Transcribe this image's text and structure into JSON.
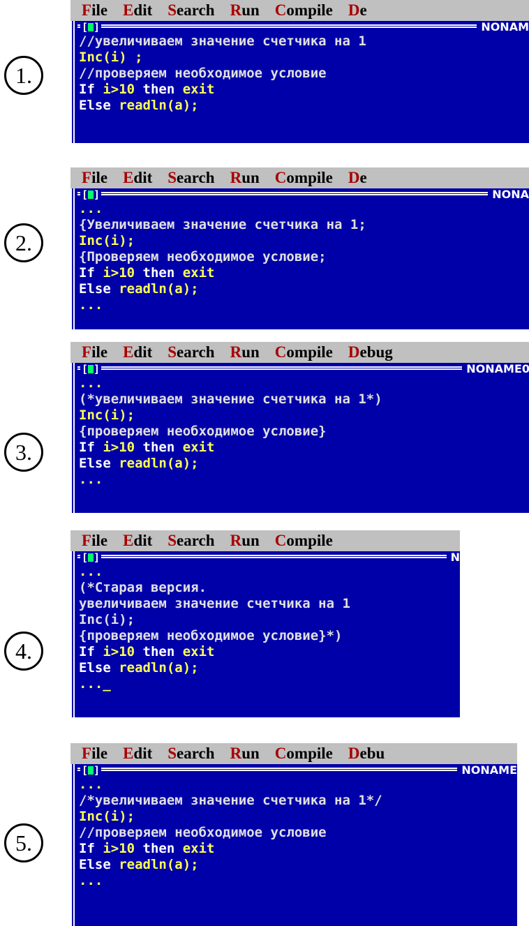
{
  "menu": [
    {
      "hot": "F",
      "rest": "ile"
    },
    {
      "hot": "E",
      "rest": "dit"
    },
    {
      "hot": "S",
      "rest": "earch"
    },
    {
      "hot": "R",
      "rest": "un"
    },
    {
      "hot": "C",
      "rest": "ompile"
    },
    {
      "hot": "D",
      "rest": "ebug"
    }
  ],
  "options": [
    {
      "number": "1.",
      "file_name": "NONAM",
      "lines": [
        [
          {
            "t": "cm",
            "v": "//увеличиваем значение счетчика на 1"
          }
        ],
        [
          {
            "t": "id",
            "v": "Inc(i) ;"
          }
        ],
        [
          {
            "t": "cm",
            "v": "//проверяем необходимое условие"
          }
        ],
        [
          {
            "t": "kw",
            "v": "If "
          },
          {
            "t": "id",
            "v": "i>10"
          },
          {
            "t": "kw",
            "v": " then "
          },
          {
            "t": "id",
            "v": "exit"
          }
        ],
        [
          {
            "t": "kw",
            "v": "Else "
          },
          {
            "t": "id",
            "v": "readln(a);"
          }
        ]
      ]
    },
    {
      "number": "2.",
      "file_name": "NONA",
      "lines": [
        [
          {
            "t": "id",
            "v": "..."
          }
        ],
        [
          {
            "t": "cm",
            "v": "{Увеличиваем значение счетчика на 1;"
          }
        ],
        [
          {
            "t": "id",
            "v": "Inc(i);"
          }
        ],
        [
          {
            "t": "cm",
            "v": "{Проверяем необходимое условие;"
          }
        ],
        [
          {
            "t": "kw",
            "v": "If "
          },
          {
            "t": "id",
            "v": "i>10"
          },
          {
            "t": "kw",
            "v": " then "
          },
          {
            "t": "id",
            "v": "exit"
          }
        ],
        [
          {
            "t": "kw",
            "v": "Else "
          },
          {
            "t": "id",
            "v": "readln(a);"
          }
        ],
        [
          {
            "t": "id",
            "v": "..."
          }
        ]
      ]
    },
    {
      "number": "3.",
      "file_name": "NONAME0",
      "lines": [
        [
          {
            "t": "id",
            "v": "..."
          }
        ],
        [
          {
            "t": "cm",
            "v": "(*увеличиваем значение счетчика на 1*)"
          }
        ],
        [
          {
            "t": "id",
            "v": "Inc(i);"
          }
        ],
        [
          {
            "t": "cm",
            "v": "{проверяем необходимое условие}"
          }
        ],
        [
          {
            "t": "kw",
            "v": "If "
          },
          {
            "t": "id",
            "v": "i>10"
          },
          {
            "t": "kw",
            "v": " then "
          },
          {
            "t": "id",
            "v": "exit"
          }
        ],
        [
          {
            "t": "kw",
            "v": "Else "
          },
          {
            "t": "id",
            "v": "readln(a);"
          }
        ],
        [
          {
            "t": "id",
            "v": "..."
          }
        ]
      ]
    },
    {
      "number": "4.",
      "file_name": "N",
      "lines": [
        [
          {
            "t": "id",
            "v": "..."
          }
        ],
        [
          {
            "t": "cm",
            "v": "(*Старая версия."
          }
        ],
        [
          {
            "t": "cm",
            "v": "увеличиваем значение счетчика на 1"
          }
        ],
        [
          {
            "t": "cm",
            "v": "Inc(i);"
          }
        ],
        [
          {
            "t": "cm",
            "v": "{проверяем необходимое условие}*)"
          }
        ],
        [
          {
            "t": "kw",
            "v": "If "
          },
          {
            "t": "id",
            "v": "i>10"
          },
          {
            "t": "kw",
            "v": " then "
          },
          {
            "t": "id",
            "v": "exit"
          }
        ],
        [
          {
            "t": "kw",
            "v": "Else "
          },
          {
            "t": "id",
            "v": "readln(a);"
          }
        ],
        [
          {
            "t": "id",
            "v": "..."
          },
          {
            "t": "cursor",
            "v": "_"
          }
        ]
      ]
    },
    {
      "number": "5.",
      "file_name": "NONAME",
      "lines": [
        [
          {
            "t": "id",
            "v": "..."
          }
        ],
        [
          {
            "t": "cm",
            "v": "/*увеличиваем значение счетчика на 1*/"
          }
        ],
        [
          {
            "t": "id",
            "v": "Inc(i);"
          }
        ],
        [
          {
            "t": "cm",
            "v": "//проверяем необходимое условие"
          }
        ],
        [
          {
            "t": "kw",
            "v": "If "
          },
          {
            "t": "id",
            "v": "i>10"
          },
          {
            "t": "kw",
            "v": " then "
          },
          {
            "t": "id",
            "v": "exit"
          }
        ],
        [
          {
            "t": "kw",
            "v": "Else "
          },
          {
            "t": "id",
            "v": "readln(a);"
          }
        ],
        [
          {
            "t": "id",
            "v": "..."
          }
        ]
      ]
    }
  ]
}
